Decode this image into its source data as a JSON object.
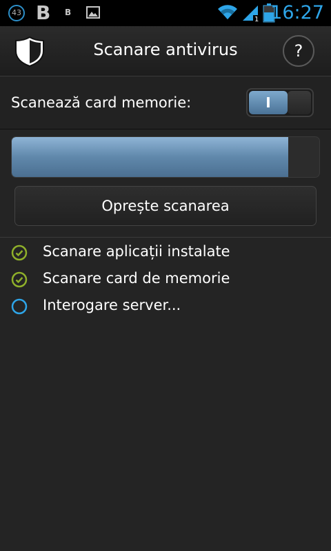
{
  "status_bar": {
    "notification_count": "43",
    "notif_icon_big": "B",
    "notif_icon_small": "B",
    "image_icon": "image-icon",
    "wifi_icon": "wifi-icon",
    "signal_icon": "signal-icon",
    "signal_badge": "1",
    "battery_icon": "battery-icon",
    "time": "16:27",
    "accent_color": "#2ea5e8"
  },
  "header": {
    "app_icon": "shield-icon",
    "title": "Scanare antivirus",
    "help_label": "?"
  },
  "memory_card": {
    "label": "Scanează card memorie:",
    "toggle_state": "I",
    "enabled": true
  },
  "scan": {
    "progress_fraction": 0.9,
    "stop_button_label": "Oprește scanarea"
  },
  "tasks": [
    {
      "label": "Scanare aplicații instalate",
      "status": "done",
      "icon": "check-circle-icon"
    },
    {
      "label": "Scanare card de memorie",
      "status": "done",
      "icon": "check-circle-icon"
    },
    {
      "label": "Interogare server...",
      "status": "in-progress",
      "icon": "progress-circle-icon"
    }
  ],
  "colors": {
    "done": "#8fb02a",
    "in_progress": "#2ea5e8",
    "progress_fill": "#6088ab"
  }
}
